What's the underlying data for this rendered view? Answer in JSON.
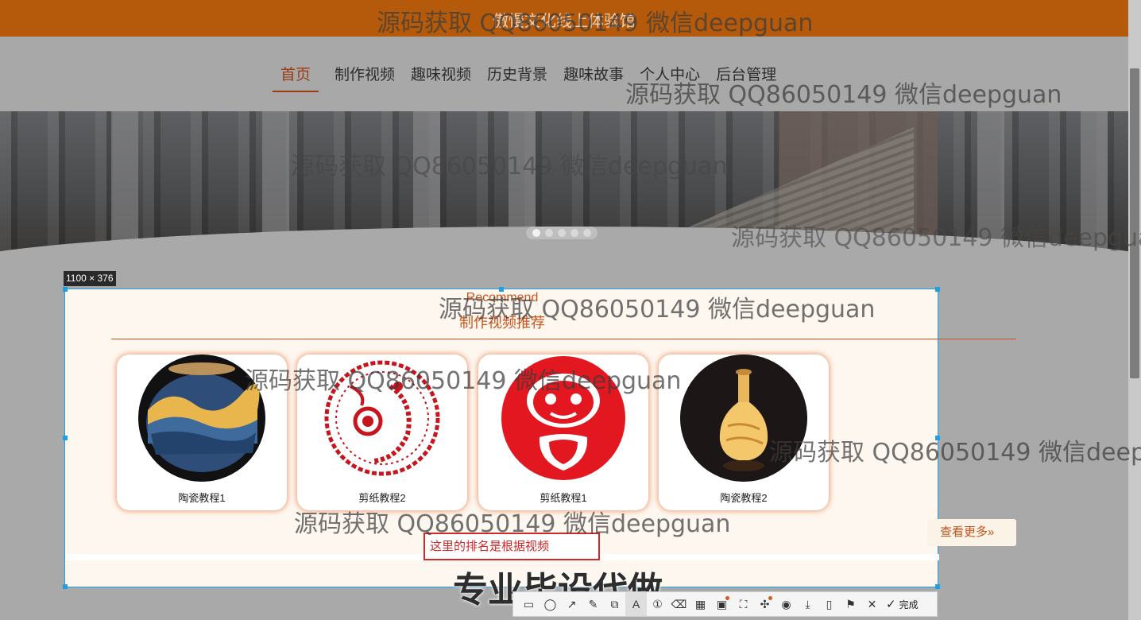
{
  "header": {
    "site_title": "傲慢文化线上体验馆"
  },
  "nav": {
    "items": [
      {
        "label": "首页",
        "active": true
      },
      {
        "label": "制作视频"
      },
      {
        "label": "趣味视频"
      },
      {
        "label": "历史背景"
      },
      {
        "label": "趣味故事"
      },
      {
        "label": "个人中心"
      },
      {
        "label": "后台管理"
      }
    ]
  },
  "banner": {
    "slide_count": 5,
    "active_slide": 1
  },
  "capture": {
    "size_label": "1100 × 376"
  },
  "section": {
    "title_en": "Recommend",
    "title_cn": "制作视频推荐",
    "more_label": "查看更多»",
    "cards": [
      {
        "caption": "陶瓷教程1",
        "image": "ceramic-vase-landscape"
      },
      {
        "caption": "剪纸教程2",
        "image": "papercut-peacock"
      },
      {
        "caption": "剪纸教程1",
        "image": "papercut-figure"
      },
      {
        "caption": "陶瓷教程2",
        "image": "ceramic-vase-lamp"
      }
    ],
    "note_text": "这里的排名是根据视频"
  },
  "toolbar": {
    "tools": [
      "rectangle-icon",
      "ellipse-icon",
      "arrow-icon",
      "pen-icon",
      "crop-icon",
      "text-icon",
      "number-icon",
      "eraser-icon",
      "mosaic-icon",
      "ocr-icon",
      "scan-icon",
      "pin-icon",
      "record-icon",
      "download-icon",
      "long-shot-icon",
      "bookmark-icon",
      "close-icon"
    ],
    "done_label": "完成"
  },
  "watermarks": {
    "text": "源码获取 QQ86050149 微信deepguan",
    "banner_text": "专业毕设代做"
  },
  "colors": {
    "topbar": "#b45a0a",
    "accent": "#c8541b",
    "selection_border": "#1ea0e4",
    "note_red": "#d2282a"
  }
}
